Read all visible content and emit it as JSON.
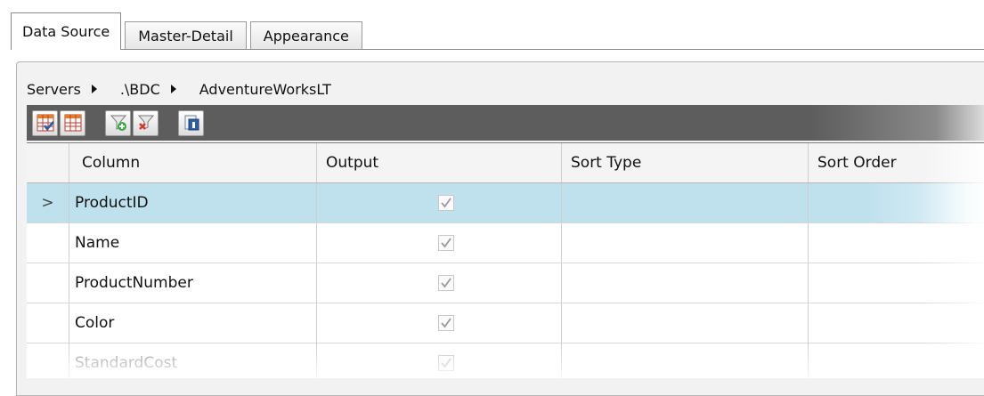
{
  "tabs": [
    {
      "label": "Data Source",
      "active": true
    },
    {
      "label": "Master-Detail",
      "active": false
    },
    {
      "label": "Appearance",
      "active": false
    }
  ],
  "breadcrumb": [
    "Servers",
    ".\\BDC",
    "AdventureWorksLT"
  ],
  "toolbar": {
    "buttons": [
      "select-all-columns-icon",
      "deselect-columns-icon",
      "add-filter-icon",
      "remove-filter-icon",
      "properties-icon"
    ]
  },
  "grid": {
    "columns": [
      "Column",
      "Output",
      "Sort Type",
      "Sort Order"
    ],
    "rows": [
      {
        "name": "ProductID",
        "output": true,
        "selected": true
      },
      {
        "name": "Name",
        "output": true,
        "selected": false
      },
      {
        "name": "ProductNumber",
        "output": true,
        "selected": false
      },
      {
        "name": "Color",
        "output": true,
        "selected": false
      },
      {
        "name": "StandardCost",
        "output": true,
        "selected": false
      }
    ],
    "row_indicator": ">"
  },
  "colors": {
    "selected_row": "#bfe1ee",
    "toolbar_bg": "#5d5d5d"
  }
}
